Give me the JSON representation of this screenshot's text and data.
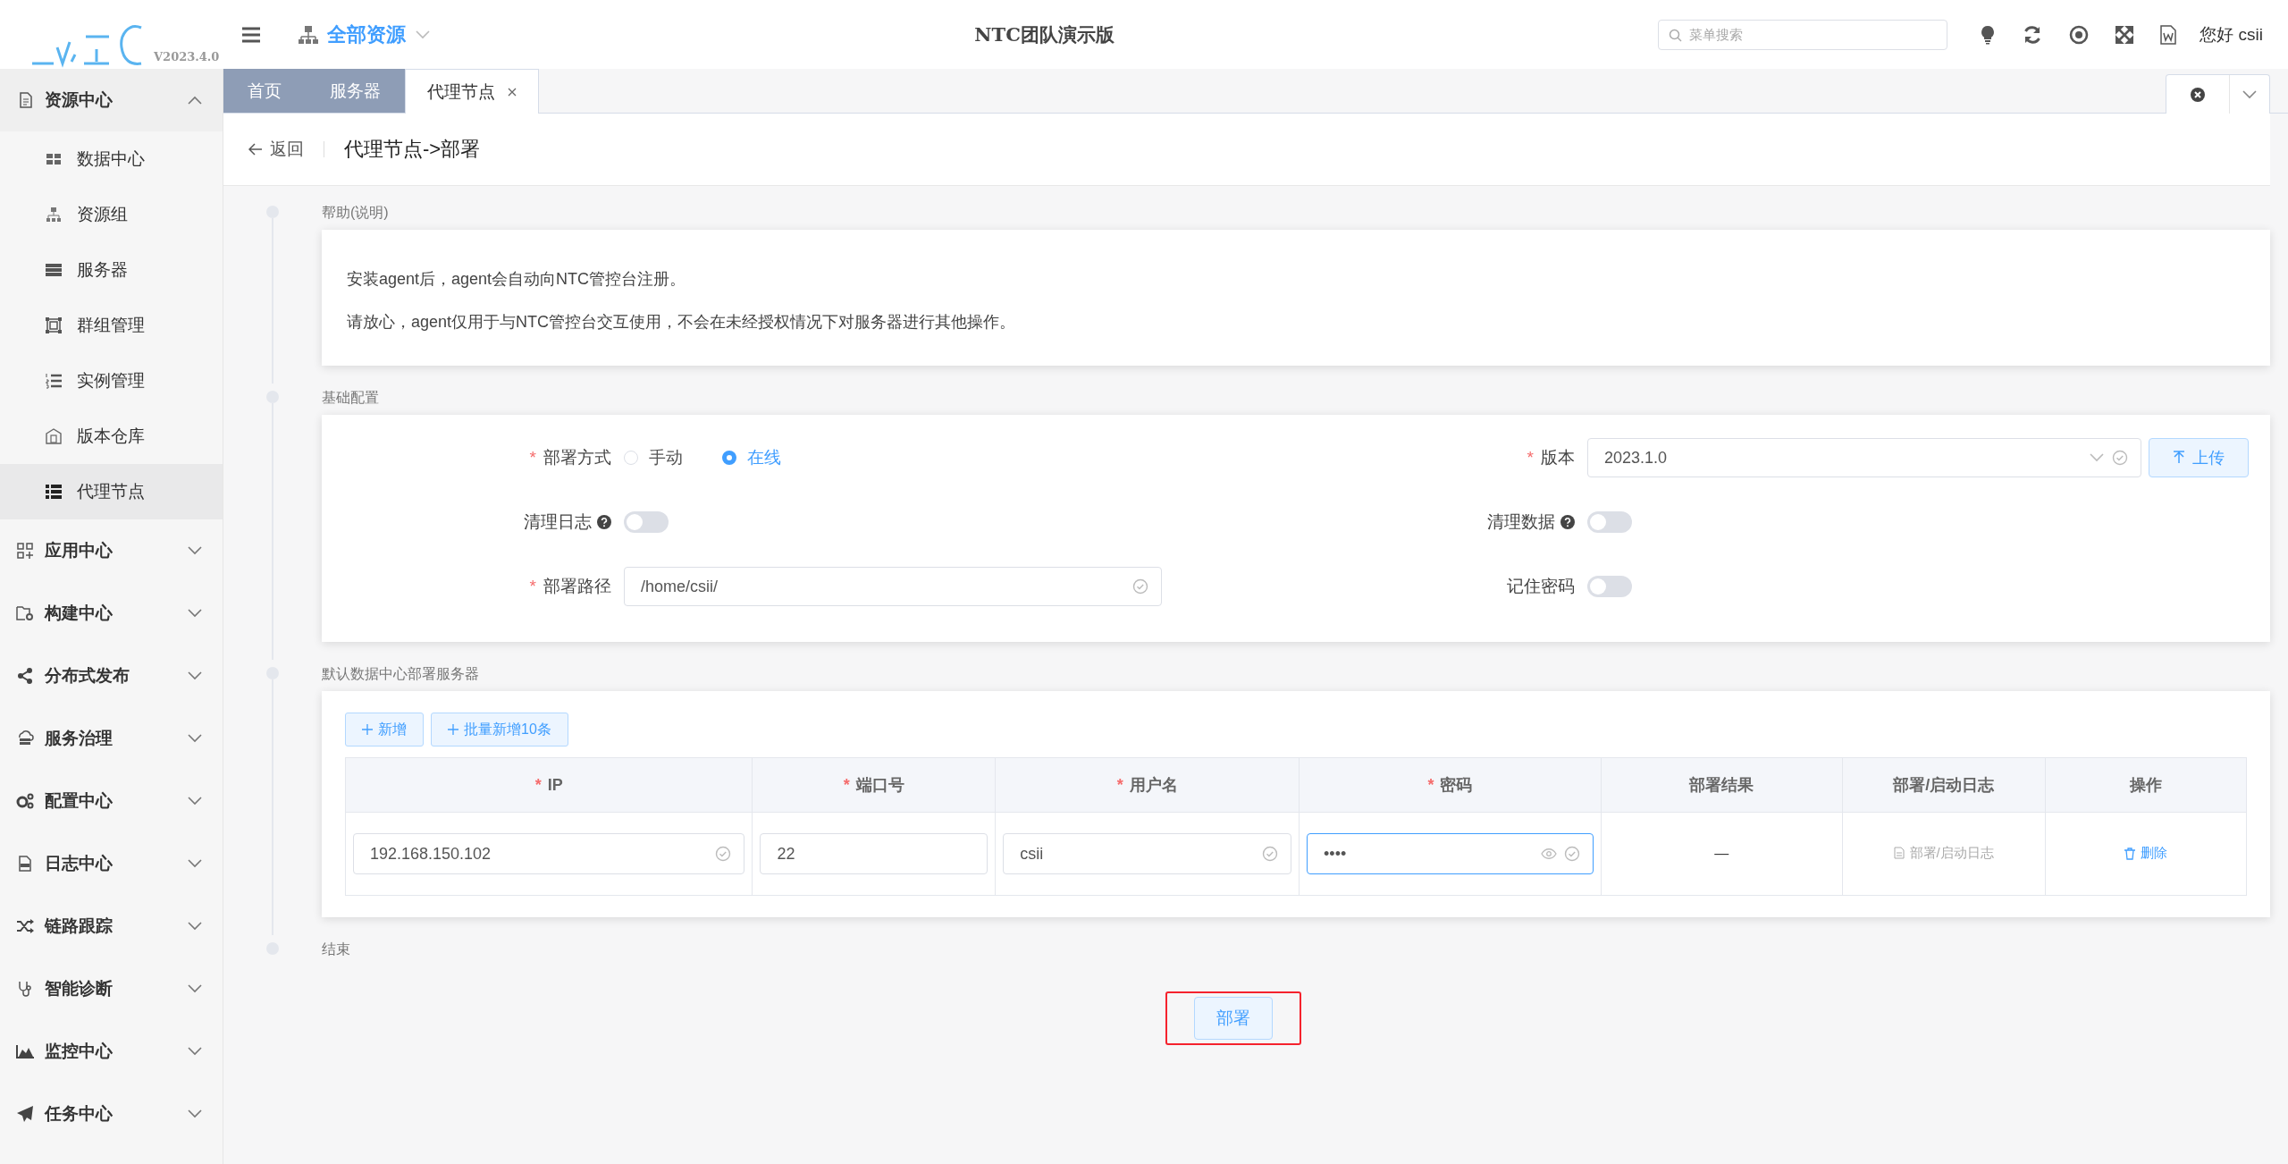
{
  "header": {
    "version": "V2023.4.0",
    "scope": "全部资源",
    "title": "NTC团队演示版",
    "search_placeholder": "菜单搜索",
    "greeting": "您好 csii"
  },
  "sidebar": {
    "groups": [
      {
        "label": "资源中心",
        "expanded": true,
        "children": [
          {
            "label": "数据中心",
            "selected": false
          },
          {
            "label": "资源组",
            "selected": false
          },
          {
            "label": "服务器",
            "selected": false
          },
          {
            "label": "群组管理",
            "selected": false
          },
          {
            "label": "实例管理",
            "selected": false
          },
          {
            "label": "版本仓库",
            "selected": false
          },
          {
            "label": "代理节点",
            "selected": true
          }
        ]
      },
      {
        "label": "应用中心",
        "expanded": false
      },
      {
        "label": "构建中心",
        "expanded": false
      },
      {
        "label": "分布式发布",
        "expanded": false
      },
      {
        "label": "服务治理",
        "expanded": false
      },
      {
        "label": "配置中心",
        "expanded": false
      },
      {
        "label": "日志中心",
        "expanded": false
      },
      {
        "label": "链路跟踪",
        "expanded": false
      },
      {
        "label": "智能诊断",
        "expanded": false
      },
      {
        "label": "监控中心",
        "expanded": false
      },
      {
        "label": "任务中心",
        "expanded": false
      }
    ]
  },
  "tabs": [
    {
      "label": "首页",
      "selected": false,
      "closable": false
    },
    {
      "label": "服务器",
      "selected": false,
      "closable": false
    },
    {
      "label": "代理节点",
      "selected": true,
      "closable": true
    }
  ],
  "page": {
    "back": "返回",
    "title": "代理节点->部署"
  },
  "help": {
    "title": "帮助(说明)",
    "lines": [
      "安装agent后，agent会自动向NTC管控台注册。",
      "请放心，agent仅用于与NTC管控台交互使用，不会在未经授权情况下对服务器进行其他操作。"
    ]
  },
  "config": {
    "title": "基础配置",
    "fields": [
      {
        "kind": "radio",
        "label": "部署方式",
        "required_mark": "*",
        "help": false,
        "options": [
          {
            "label": "手动",
            "selected": false
          },
          {
            "label": "在线",
            "selected": true
          }
        ]
      },
      {
        "kind": "select",
        "label": "版本",
        "required_mark": "*",
        "help": false,
        "value": "2023.1.0",
        "button": "上传"
      },
      {
        "kind": "toggle",
        "label": "清理日志",
        "help": true,
        "on": false
      },
      {
        "kind": "toggle",
        "label": "清理数据",
        "help": true,
        "on": false
      },
      {
        "kind": "input",
        "label": "部署路径",
        "required_mark": "*",
        "help": false,
        "value": "/home/csii/"
      },
      {
        "kind": "toggle",
        "label": "记住密码",
        "help": false,
        "on": false
      }
    ]
  },
  "servers": {
    "title": "默认数据中心部署服务器",
    "buttons": [
      "新增",
      "批量新增10条"
    ],
    "columns": [
      {
        "label": "IP",
        "required_mark": "*"
      },
      {
        "label": "端口号",
        "required_mark": "*"
      },
      {
        "label": "用户名",
        "required_mark": "*"
      },
      {
        "label": "密码",
        "required_mark": "*"
      },
      {
        "label": "部署结果"
      },
      {
        "label": "部署/启动日志"
      },
      {
        "label": "操作"
      }
    ],
    "rows": [
      {
        "ip": "192.168.150.102",
        "port": "22",
        "user": "csii",
        "password": "••••",
        "result": "—",
        "log": "部署/启动日志",
        "action": "删除"
      }
    ]
  },
  "end": {
    "title": "结束"
  },
  "submit": {
    "label": "部署",
    "highlighted": true
  }
}
